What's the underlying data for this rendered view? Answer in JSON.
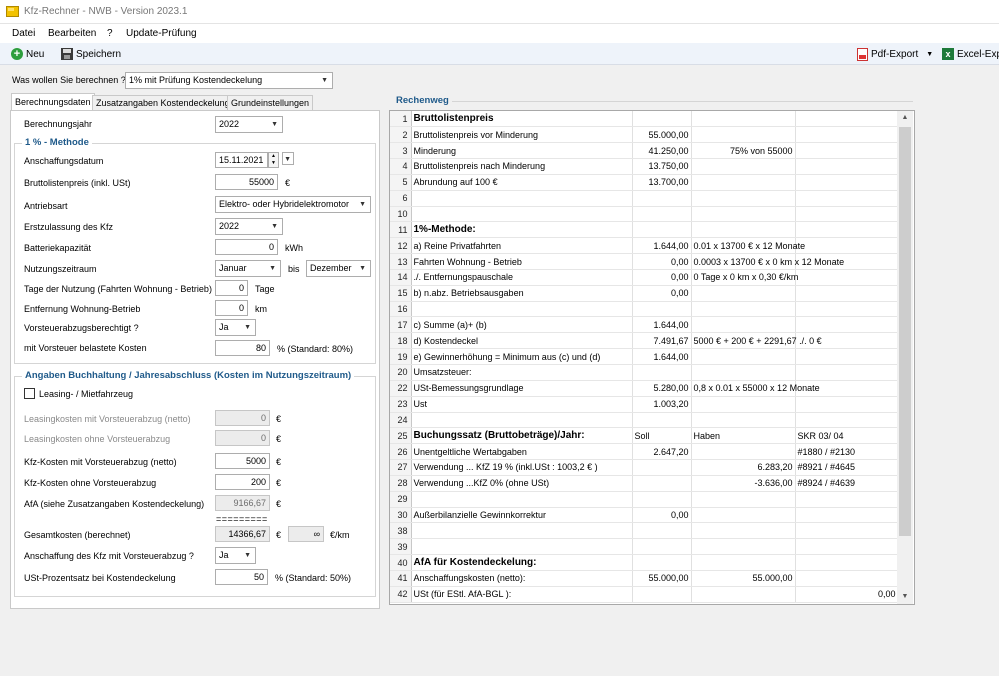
{
  "window": {
    "title": "Kfz-Rechner  - NWB - Version 2023.1"
  },
  "menu": [
    "Datei",
    "Bearbeiten",
    "?",
    "Update-Prüfung"
  ],
  "toolbar": {
    "new": "Neu",
    "save": "Speichern",
    "pdf": "Pdf-Export",
    "excel": "Excel-Exp"
  },
  "calc": {
    "label": "Was wollen Sie berechnen ?",
    "value": "1% mit Prüfung Kostendeckelung"
  },
  "tabs": [
    "Berechnungsdaten",
    "Zusatzangaben Kostendeckelung",
    "Grundeinstellungen"
  ],
  "form": {
    "year_label": "Berechnungsjahr",
    "year": "2022",
    "section1": "1 % - Methode",
    "date_label": "Anschaffungsdatum",
    "date": "15.11.2021",
    "price_label": "Bruttolistenpreis (inkl. USt)",
    "price": "55000",
    "price_unit": "€",
    "drive_label": "Antriebsart",
    "drive": "Elektro- oder Hybridelektromotor",
    "firstreg_label": "Erstzulassung des Kfz",
    "firstreg": "2022",
    "battery_label": "Batteriekapazität",
    "battery": "0",
    "battery_unit": "kWh",
    "period_label": "Nutzungszeitraum",
    "period_from": "Januar",
    "period_bis": "bis",
    "period_to": "Dezember",
    "days_label": "Tage der Nutzung (Fahrten Wohnung - Betrieb)",
    "days": "0",
    "days_unit": "Tage",
    "dist_label": "Entfernung Wohnung-Betrieb",
    "dist": "0",
    "dist_unit": "km",
    "vst_label": "Vorsteuerabzugsberechtigt ?",
    "vst": "Ja",
    "vstcost_label": "mit Vorsteuer belastete Kosten",
    "vstcost": "80",
    "vstcost_unit": "%  (Standard: 80%)",
    "section2": "Angaben Buchhaltung / Jahresabschluss (Kosten im Nutzungszeitraum)",
    "leasing_label": "Leasing- / Mietfahrzeug",
    "leas_with_label": "Leasingkosten mit Vorsteuerabzug (netto)",
    "leas_with": "0",
    "leas_without_label": "Leasingkosten ohne Vorsteuerabzug",
    "leas_without": "0",
    "kfz_with_label": "Kfz-Kosten mit Vorsteuerabzug (netto)",
    "kfz_with": "5000",
    "kfz_without_label": "Kfz-Kosten ohne Vorsteuerabzug",
    "kfz_without": "200",
    "afa_label": "AfA (siehe Zusatzangaben Kostendeckelung)",
    "afa": "9166,67",
    "separator": "=========",
    "total_label": "Gesamtkosten (berechnet)",
    "total": "14366,67",
    "per_km": "∞",
    "per_km_unit": "€/km",
    "purchase_vst_label": "Anschaffung des Kfz mit Vorsteuerabzug ?",
    "purchase_vst": "Ja",
    "ust_label": "USt-Prozentsatz bei Kostendeckelung",
    "ust": "50",
    "ust_unit": "%  (Standard: 50%)",
    "euro": "€"
  },
  "rechenweg": {
    "title": "Rechenweg",
    "rows": [
      {
        "n": "1",
        "a": "Bruttolistenpreis",
        "b": "",
        "c": "",
        "d": "",
        "h": true
      },
      {
        "n": "2",
        "a": "Bruttolistenpreis vor Minderung",
        "b": "55.000,00",
        "c": "",
        "d": ""
      },
      {
        "n": "3",
        "a": "Minderung",
        "b": "41.250,00",
        "c": "75% von 55000",
        "d": ""
      },
      {
        "n": "4",
        "a": "Bruttolistenpreis nach Minderung",
        "b": "13.750,00",
        "c": "",
        "d": ""
      },
      {
        "n": "5",
        "a": "Abrundung auf 100 €",
        "b": "13.700,00",
        "c": "",
        "d": ""
      },
      {
        "n": "6",
        "a": "",
        "b": "",
        "c": "",
        "d": ""
      },
      {
        "n": "10",
        "a": "",
        "b": "",
        "c": "",
        "d": ""
      },
      {
        "n": "11",
        "a": "1%-Methode:",
        "b": "",
        "c": "",
        "d": "",
        "h": true
      },
      {
        "n": "12",
        "a": "a) Reine Privatfahrten",
        "b": "1.644,00",
        "c": "0.01 x 13700 € x 12 Monate",
        "d": ""
      },
      {
        "n": "13",
        "a": "   Fahrten Wohnung - Betrieb",
        "b": "0,00",
        "c": "0.0003 x 13700 € x 0 km x 12 Monate",
        "d": ""
      },
      {
        "n": "14",
        "a": "  ./. Entfernungspauschale",
        "b": "0,00",
        "c": "0 Tage x 0 km x 0,30 €/km",
        "d": ""
      },
      {
        "n": "15",
        "a": "b) n.abz. Betriebsausgaben",
        "b": "0,00",
        "c": "",
        "d": ""
      },
      {
        "n": "16",
        "a": "",
        "b": "",
        "c": "",
        "d": ""
      },
      {
        "n": "17",
        "a": "c) Summe (a)+ (b)",
        "b": "1.644,00",
        "c": "",
        "d": ""
      },
      {
        "n": "18",
        "a": "d) Kostendeckel",
        "b": "7.491,67",
        "c": "5000 € + 200 € + 2291,67 ./. 0 €",
        "d": ""
      },
      {
        "n": "19",
        "a": "e) Gewinnerhöhung = Minimum aus (c) und (d)",
        "b": "1.644,00",
        "c": "",
        "d": ""
      },
      {
        "n": "20",
        "a": "Umsatzsteuer:",
        "b": "",
        "c": "",
        "d": ""
      },
      {
        "n": "22",
        "a": "USt-Bemessungsgrundlage",
        "b": "5.280,00",
        "c": "0,8 x 0.01 x 55000 x 12 Monate",
        "d": ""
      },
      {
        "n": "23",
        "a": "Ust",
        "b": "1.003,20",
        "c": "",
        "d": ""
      },
      {
        "n": "24",
        "a": "",
        "b": "",
        "c": "",
        "d": ""
      },
      {
        "n": "25",
        "a": "Buchungssatz (Bruttobeträge)/Jahr:",
        "b": "Soll",
        "c": "Haben",
        "d": "SKR 03/ 04",
        "h": true,
        "left": true
      },
      {
        "n": "26",
        "a": "Unentgeltliche Wertabgaben",
        "b": "2.647,20",
        "c": "",
        "d": "#1880 / #2130"
      },
      {
        "n": "27",
        "a": "Verwendung ... KfZ 19 % (inkl.USt : 1003,2 € )",
        "b": "",
        "c": "6.283,20",
        "d": "#8921 / #4645"
      },
      {
        "n": "28",
        "a": "Verwendung ...KfZ 0% (ohne USt)",
        "b": "",
        "c": "-3.636,00",
        "d": "#8924 / #4639"
      },
      {
        "n": "29",
        "a": "",
        "b": "",
        "c": "",
        "d": ""
      },
      {
        "n": "30",
        "a": "Außerbilanzielle Gewinnkorrektur",
        "b": "0,00",
        "c": "",
        "d": ""
      },
      {
        "n": "38",
        "a": "",
        "b": "",
        "c": "",
        "d": ""
      },
      {
        "n": "39",
        "a": "",
        "b": "",
        "c": "",
        "d": ""
      },
      {
        "n": "40",
        "a": "AfA für Kostendeckelung:",
        "b": "",
        "c": "",
        "d": "",
        "h": true
      },
      {
        "n": "41",
        "a": "Anschaffungskosten (netto):",
        "b": "55.000,00",
        "c": "55.000,00",
        "d": ""
      },
      {
        "n": "42",
        "a": "USt (für EStl. AfA-BGL ):",
        "b": "",
        "c": "",
        "d": "0,00"
      }
    ]
  }
}
